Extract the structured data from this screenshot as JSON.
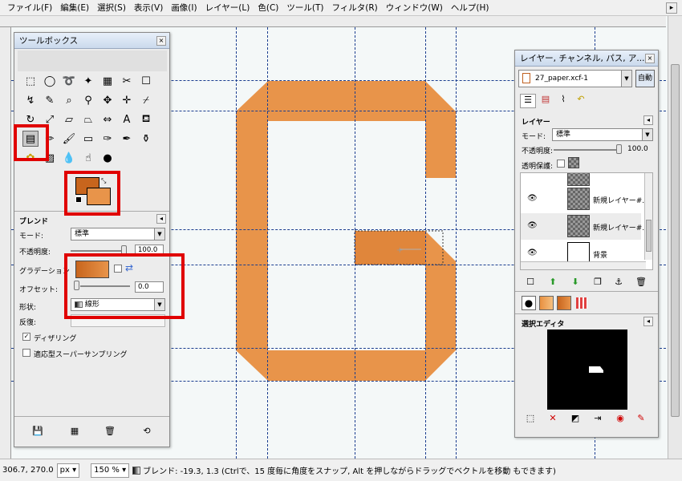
{
  "menubar": {
    "items": [
      "ファイル(F)",
      "編集(E)",
      "選択(S)",
      "表示(V)",
      "画像(I)",
      "レイヤー(L)",
      "色(C)",
      "ツール(T)",
      "フィルタ(R)",
      "ウィンドウ(W)",
      "ヘルプ(H)"
    ]
  },
  "toolbox": {
    "title": "ツールボックス",
    "blend_section": "ブレンド",
    "mode_label": "モード:",
    "mode_value": "標準",
    "opacity_label": "不透明度:",
    "opacity_value": "100.0",
    "opacity_percent": 100,
    "gradient_label": "グラデーション",
    "offset_label": "オフセット:",
    "offset_value": "0.0",
    "shape_label": "形状:",
    "shape_value": "線形",
    "repeat_label": "反復:",
    "dither_label": "ディザリング",
    "dither_checked": true,
    "supersample_label": "適応型スーパーサンプリング",
    "supersample_checked": false,
    "fg_color": "#c8651d",
    "bg_color": "#e8944a"
  },
  "layers_panel": {
    "title": "レイヤー, チャンネル, パス, ア...",
    "image_name": "27_paper.xcf-1",
    "auto_button": "自動",
    "section_title": "レイヤー",
    "mode_label": "モード:",
    "mode_value": "標準",
    "opacity_label": "不透明度:",
    "opacity_value": "100.0",
    "lock_label": "透明保護:",
    "layers": [
      {
        "name": "新規レイヤー#..."
      },
      {
        "name": "新規レイヤー#..."
      },
      {
        "name": "背景"
      }
    ],
    "selection_editor_title": "選択エディタ"
  },
  "status": {
    "coords": "306.7, 270.0",
    "unit": "px",
    "zoom": "150 %",
    "message": "ブレンド: -19.3, 1.3 (Ctrlで、15 度毎に角度をスナップ, Alt を押しながらドラッグでベクトルを移動 もできます)"
  },
  "colors": {
    "shape_orange": "#e8944a",
    "highlight_red": "#e00000",
    "guide_blue": "#1a3d8f"
  }
}
